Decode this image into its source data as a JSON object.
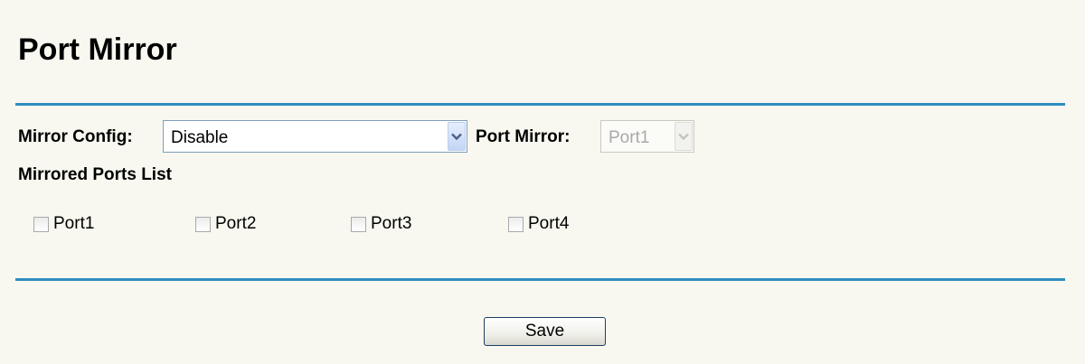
{
  "page": {
    "title": "Port Mirror"
  },
  "mirror_config": {
    "label": "Mirror Config:",
    "selected": "Disable"
  },
  "port_mirror": {
    "label": "Port Mirror:",
    "selected": "Port1",
    "disabled": true
  },
  "mirrored_ports": {
    "label": "Mirrored Ports List",
    "ports": [
      {
        "label": "Port1",
        "checked": false
      },
      {
        "label": "Port2",
        "checked": false
      },
      {
        "label": "Port3",
        "checked": false
      },
      {
        "label": "Port4",
        "checked": false
      }
    ]
  },
  "actions": {
    "save_label": "Save"
  },
  "colors": {
    "accent_rule": "#2f8dbf",
    "background": "#f8f8f0"
  }
}
